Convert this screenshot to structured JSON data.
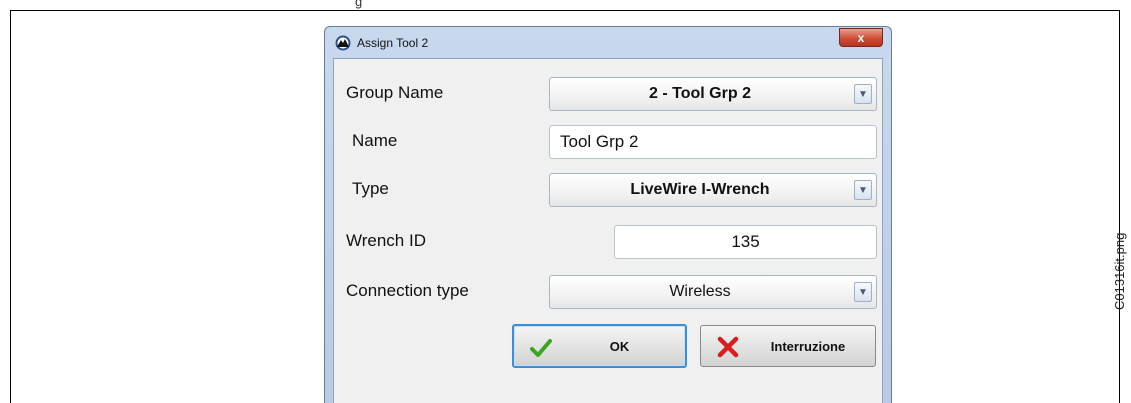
{
  "caption": "C01316it.png",
  "top_cut_text": "g",
  "dialog": {
    "title": "Assign Tool  2",
    "close_label": "x"
  },
  "form": {
    "group_name": {
      "label": "Group Name",
      "value": "2 - Tool Grp 2"
    },
    "name": {
      "label": "Name",
      "value": "Tool Grp 2"
    },
    "type": {
      "label": "Type",
      "value": "LiveWire I-Wrench"
    },
    "wrench_id": {
      "label": "Wrench ID",
      "value": "135"
    },
    "connection_type": {
      "label": "Connection type",
      "value": "Wireless"
    }
  },
  "buttons": {
    "ok": "OK",
    "cancel": "Interruzione"
  },
  "icons": {
    "app": "app-logo-icon",
    "combo_arrow": "chevron-down-icon",
    "ok": "checkmark-icon",
    "cancel": "red-x-icon",
    "close": "close-icon"
  },
  "colors": {
    "close_button": "#cf4d35",
    "ok_focus_border": "#3c8fd6",
    "check_green": "#3aa51f",
    "cancel_red": "#d81e1e"
  }
}
